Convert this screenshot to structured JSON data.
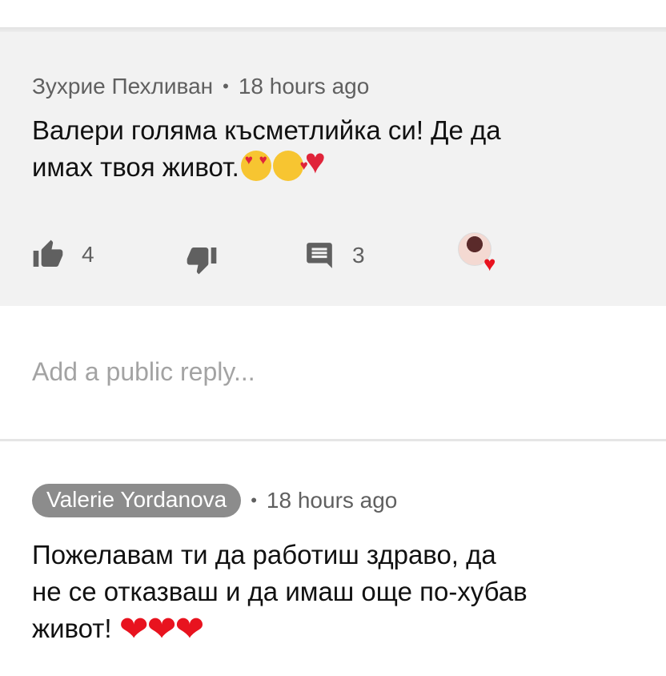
{
  "comment": {
    "author": "Зухрие Пехливан",
    "separator": "•",
    "time": "18 hours ago",
    "text": "Валери голяма късметлийка си! Де да\nимах твоя живот.",
    "emojis": [
      "smiling-face-with-heart-eyes",
      "face-blowing-a-kiss",
      "sparkling-heart"
    ],
    "likes": "4",
    "replies": "3",
    "icons": {
      "like": "thumb-up-icon",
      "dislike": "thumb-down-icon",
      "reply": "comment-icon",
      "creator_heart": "heart-icon"
    }
  },
  "reply_box": {
    "placeholder": "Add a public reply..."
  },
  "reply": {
    "author": "Valerie Yordanova",
    "separator": "•",
    "time": "18 hours ago",
    "text": "Пожелавам ти да работиш здраво, да\nне се отказваш и да имаш още по-хубав\nживот!",
    "emojis": [
      "red-heart",
      "red-heart",
      "red-heart"
    ],
    "hearts": "❤❤❤"
  },
  "colors": {
    "card_background": "#f2f2f2",
    "meta_text": "#606060",
    "author_chip": "#8c8c8c",
    "heart_red": "#e8131f"
  }
}
